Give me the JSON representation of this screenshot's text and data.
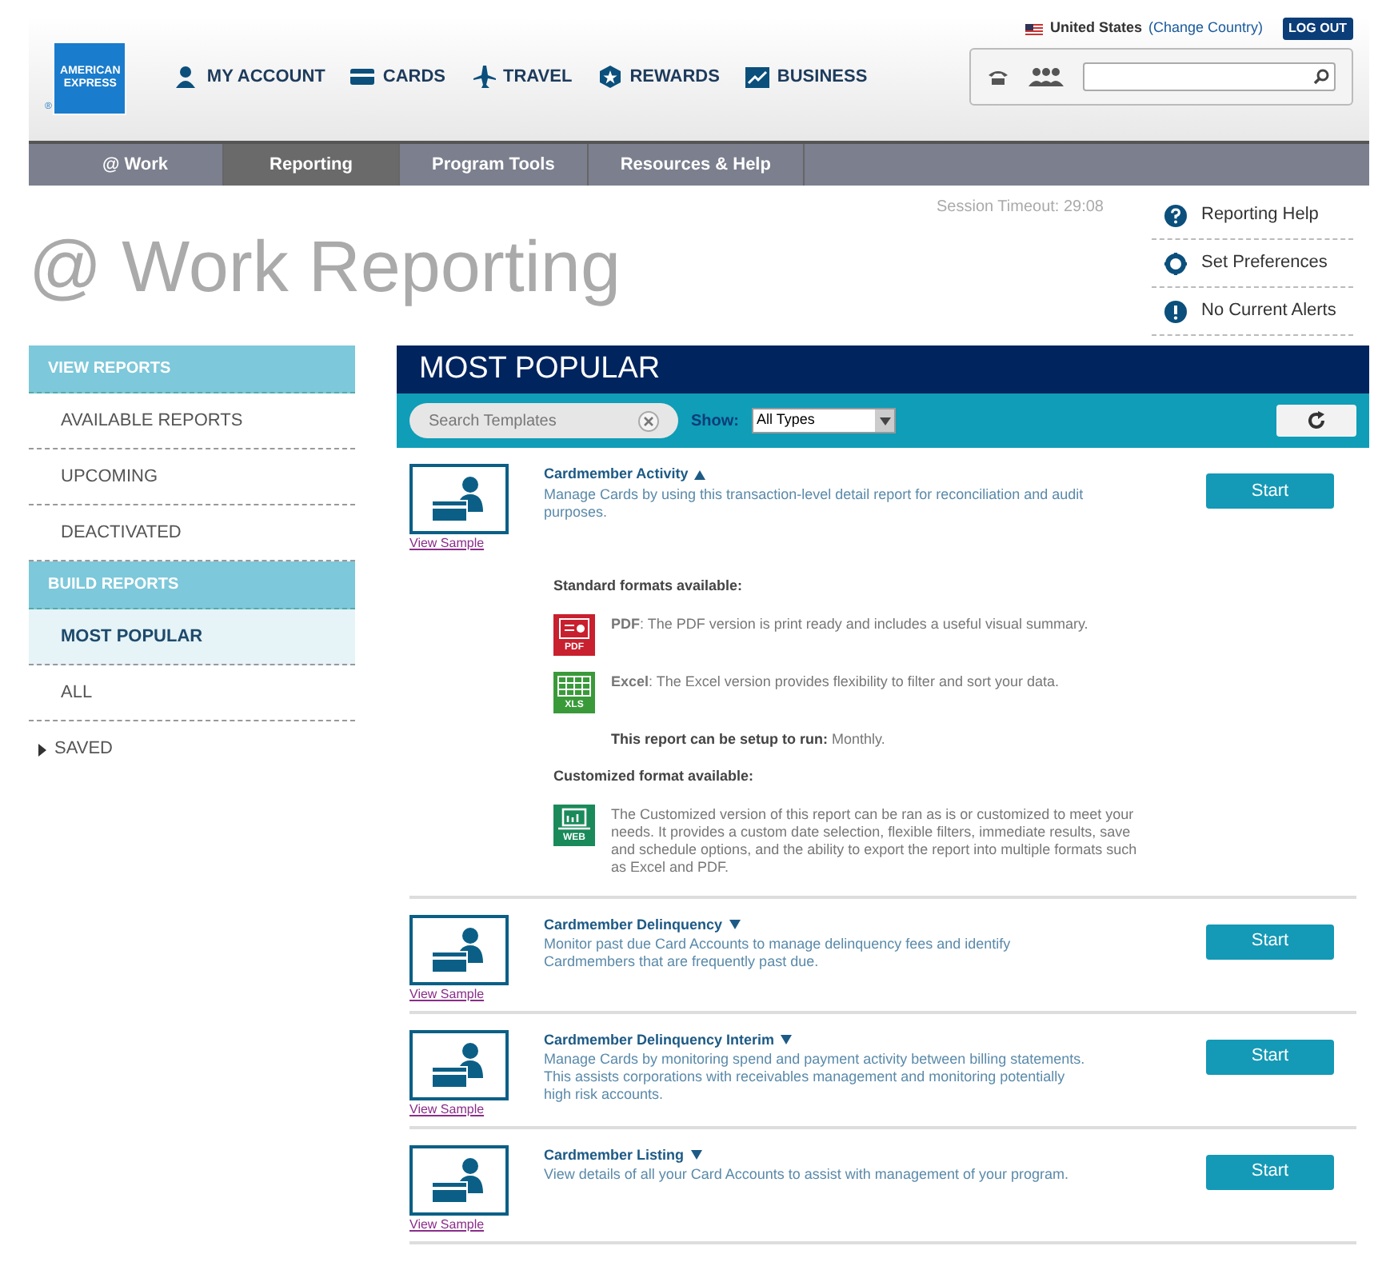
{
  "header": {
    "logo": [
      "AMERICAN",
      "EXPRESS"
    ],
    "logo_mark": "®",
    "country": "United States",
    "change_country": "(Change Country)",
    "logout": "LOG OUT",
    "nav": [
      {
        "label": "MY ACCOUNT",
        "kind": "person"
      },
      {
        "label": "CARDS",
        "kind": "card"
      },
      {
        "label": "TRAVEL",
        "kind": "plane"
      },
      {
        "label": "REWARDS",
        "kind": "star"
      },
      {
        "label": "BUSINESS",
        "kind": "chart"
      }
    ]
  },
  "tabs": [
    {
      "label": "@ Work",
      "selected": false
    },
    {
      "label": "Reporting",
      "selected": true
    },
    {
      "label": "Program Tools",
      "selected": false
    },
    {
      "label": "Resources & Help",
      "selected": false
    }
  ],
  "page_title": "@ Work Reporting",
  "session_timeout": "Session Timeout: 29:08",
  "help_links": [
    {
      "label": "Reporting Help",
      "kind": "question"
    },
    {
      "label": "Set Preferences",
      "kind": "gear"
    },
    {
      "label": "No Current Alerts",
      "kind": "alert"
    }
  ],
  "sidebar": [
    {
      "label": "VIEW REPORTS",
      "kind": "heading"
    },
    {
      "label": "AVAILABLE REPORTS",
      "kind": "item",
      "selected": false
    },
    {
      "label": "UPCOMING",
      "kind": "item",
      "selected": false
    },
    {
      "label": "DEACTIVATED",
      "kind": "item",
      "selected": false
    },
    {
      "label": "BUILD REPORTS",
      "kind": "heading"
    },
    {
      "label": "MOST POPULAR",
      "kind": "item",
      "selected": true
    },
    {
      "label": "ALL",
      "kind": "item",
      "selected": false
    },
    {
      "label": "SAVED",
      "kind": "folder",
      "selected": false
    }
  ],
  "panel": {
    "title": "MOST POPULAR",
    "search": {
      "placeholder": "Search Templates"
    },
    "show_label": "Show:",
    "show_value": "All Types"
  },
  "reports": [
    {
      "title": "Cardmember Activity",
      "expanded": true,
      "description": "Manage Cards by using this transaction-level detail report for reconciliation and audit purposes.",
      "sample": "View Sample",
      "action": "Start",
      "details": {
        "standard_heading": "Standard formats available:",
        "formats": [
          {
            "kind": "pdf",
            "badge": "PDF",
            "text": "**PDF**: The PDF version is print ready and includes a useful visual summary."
          },
          {
            "kind": "xls",
            "badge": "XLS",
            "text": "**Excel**: The Excel version provides flexibility to filter and sort your data."
          }
        ],
        "schedule": "**This report can be setup to run:** Monthly.",
        "custom_heading": "Customized format available:",
        "custom": {
          "kind": "web",
          "badge": "WEB",
          "text": "The Customized version of this report can be ran as is or customized to meet your needs. It provides a custom date selection, flexible filters, immediate results, save and schedule options, and the ability to export the report into multiple formats such as Excel and PDF."
        }
      }
    },
    {
      "title": "Cardmember Delinquency",
      "expanded": false,
      "description": "Monitor past due Card Accounts to manage delinquency fees and identify Cardmembers that are frequently past due.",
      "sample": "View Sample",
      "action": "Start"
    },
    {
      "title": "Cardmember Delinquency Interim",
      "expanded": false,
      "description": "Manage Cards by monitoring spend and payment activity between billing statements. This assists corporations with receivables management and monitoring potentially high risk accounts.",
      "sample": "View Sample",
      "action": "Start"
    },
    {
      "title": "Cardmember Listing",
      "expanded": false,
      "description": "View details of all your Card Accounts to assist with management of your program.",
      "sample": "View Sample",
      "action": "Start"
    }
  ]
}
